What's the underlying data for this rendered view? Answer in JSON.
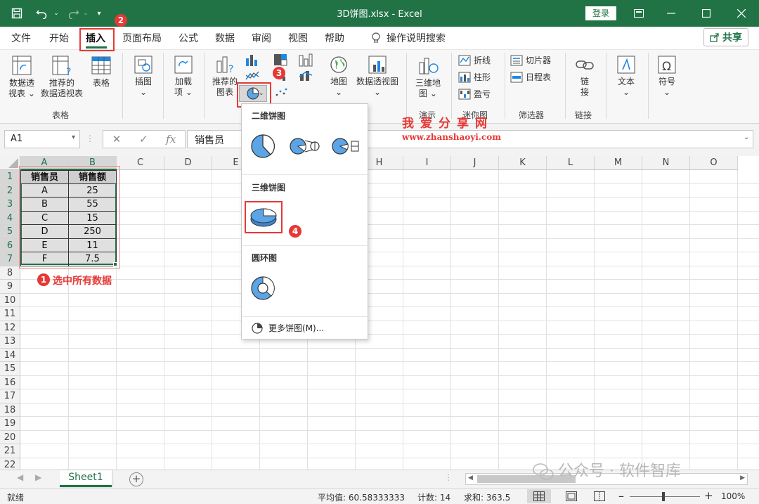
{
  "titlebar": {
    "title": "3D饼图.xlsx  -  Excel",
    "login": "登录"
  },
  "tabs": [
    "文件",
    "开始",
    "插入",
    "页面布局",
    "公式",
    "数据",
    "审阅",
    "视图",
    "帮助"
  ],
  "search_tab": "操作说明搜索",
  "share": "共享",
  "ribbon": {
    "pivot_line1": "数据透",
    "pivot_line2": "视表",
    "rec_pivot_line1": "推荐的",
    "rec_pivot_line2": "数据透视表",
    "table": "表格",
    "group_tables": "表格",
    "illustrations": "插图",
    "addins_line1": "加载",
    "addins_line2": "项",
    "rec_charts_line1": "推荐的",
    "rec_charts_line2": "图表",
    "map": "地图",
    "pivot_chart": "数据透视图",
    "map3d_line1": "三维地",
    "map3d_line2": "图",
    "group_tours": "演示",
    "sparkline_line": "折线",
    "sparkline_column": "柱形",
    "sparkline_winloss": "盈亏",
    "group_sparklines": "迷你图",
    "slicer": "切片器",
    "timeline": "日程表",
    "group_filters": "筛选器",
    "link": "链接",
    "link_v1": "链",
    "link_v2": "接",
    "group_links": "链接",
    "text": "文本",
    "symbol": "符号"
  },
  "formulabar": {
    "namebox": "A1",
    "fx": "fx",
    "value": "销售员"
  },
  "columns": [
    "A",
    "B",
    "C",
    "D",
    "E",
    "F",
    "G",
    "H",
    "I",
    "J",
    "K",
    "L",
    "M",
    "N",
    "O"
  ],
  "rows": [
    "1",
    "2",
    "3",
    "4",
    "5",
    "6",
    "7",
    "8",
    "9",
    "10",
    "11",
    "12",
    "13",
    "14",
    "15",
    "16",
    "17",
    "18",
    "19",
    "20",
    "21",
    "22"
  ],
  "table": {
    "headers": [
      "销售员",
      "销售额"
    ],
    "rows": [
      [
        "A",
        "25"
      ],
      [
        "B",
        "55"
      ],
      [
        "C",
        "15"
      ],
      [
        "D",
        "250"
      ],
      [
        "E",
        "11"
      ],
      [
        "F",
        "7.5"
      ]
    ]
  },
  "dropdown": {
    "section_2d": "二维饼图",
    "section_3d": "三维饼图",
    "section_donut": "圆环图",
    "more": "更多饼图(M)..."
  },
  "annotations": {
    "b1": "1",
    "b2": "2",
    "b3": "3",
    "b4": "4",
    "note": "选中所有数据",
    "watermark_title": "我爱分享网",
    "watermark_url": "www.zhanshaoyi.com",
    "watermark_footer": "公众号 · 软件智库"
  },
  "sheet": {
    "tab": "Sheet1",
    "add": "+"
  },
  "status": {
    "ready": "就绪",
    "average": "平均值: 60.58333333",
    "count": "计数: 14",
    "sum": "求和: 363.5",
    "zoom": "100%"
  },
  "colors": {
    "excel_green": "#217346",
    "annotation_red": "#e53935",
    "pie_blue": "#5ba4e6"
  }
}
